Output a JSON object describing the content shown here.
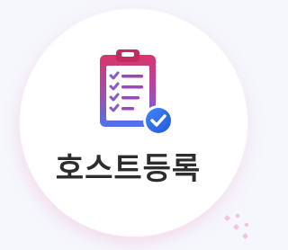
{
  "card": {
    "label": "호스트등록",
    "icon": "clipboard-check-icon"
  },
  "colors": {
    "background": "#f5f7fc",
    "card": "#ffffff",
    "icon_gradient_top": "#d9356b",
    "icon_gradient_bottom": "#4a73f0",
    "check_badge": "#2f6fea",
    "label_text": "#2d2d2d"
  }
}
